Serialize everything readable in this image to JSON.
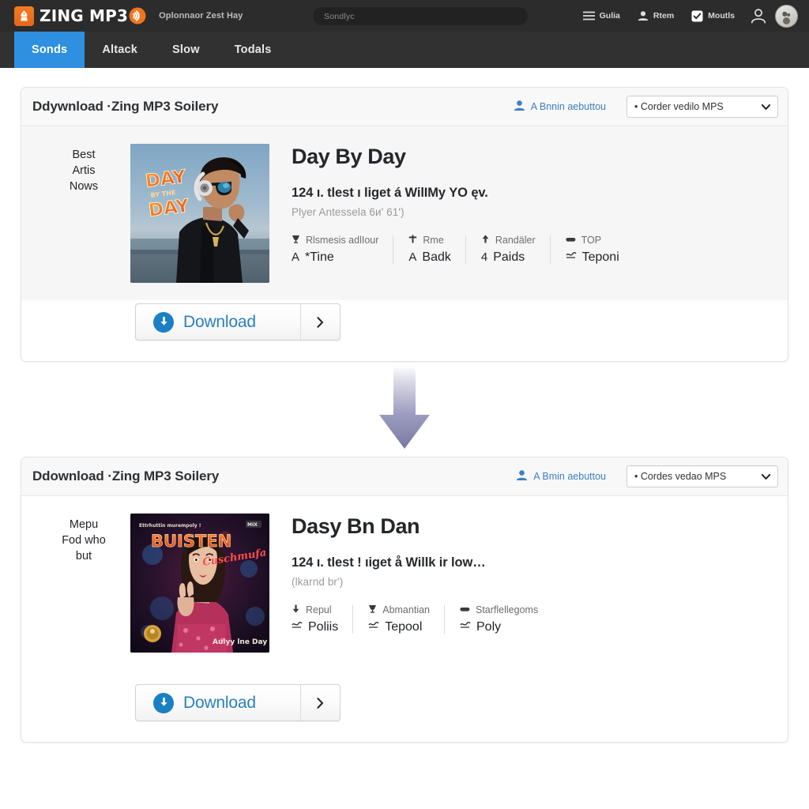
{
  "header": {
    "logo_text": "ZING MP3",
    "logo_icon": "flame-badge-icon",
    "wave_icon": "sound-wave-icon",
    "tagline": "Oplonnaor Zest Hay",
    "search": {
      "placeholder": "Sondlyc",
      "icon": "search-input"
    },
    "actions": [
      {
        "label": "Gulia",
        "icon": "hamburger-menu-icon"
      },
      {
        "label": "Rtem",
        "icon": "user-filled-icon"
      },
      {
        "label": "Moutls",
        "icon": "checkbox-checked-icon"
      }
    ],
    "account_icon": "user-outline-icon",
    "avatar": "avatar-image",
    "tabs": [
      {
        "label": "Sonds",
        "active": true
      },
      {
        "label": "Altack",
        "active": false
      },
      {
        "label": "Slow",
        "active": false
      },
      {
        "label": "Todals",
        "active": false
      }
    ]
  },
  "arrow": {
    "icon": "down-arrow-graphic",
    "color": "#7b7aa8"
  },
  "cards": [
    {
      "title": "Ddywnload ·Zing MP3 Soilery",
      "head_link": {
        "label": "A Bnnin aebuttou",
        "icon": "user-badge-icon"
      },
      "head_select": {
        "value": "• Corder vedilo MPS",
        "caret": "chevron-down-icon"
      },
      "side_note": "Best\nArtis\nNows",
      "art": {
        "name": "album-art-day-by-day",
        "overlay_text": "DAY\nBY\nDAY",
        "style": "male-singer-headphones"
      },
      "song_title": "Day By Day",
      "song_sub": "124 ı. tlest ı liget á WilIMy YO ęv.",
      "song_sub2": "Plyer Antessela 6и' 61')",
      "stats": [
        {
          "top_icon": "trophy-icon",
          "top": "Rlsmesis adlIour",
          "bot_icon": "letter-a-icon",
          "bot": "*Tine"
        },
        {
          "top_icon": "plus-bold-icon",
          "top": "Rme",
          "bot_icon": "letter-a-icon",
          "bot": "Badk"
        },
        {
          "top_icon": "up-arrow-icon",
          "top": "Randäler",
          "bot_icon": "digit-4-icon",
          "bot": "Paids"
        },
        {
          "top_icon": "tag-icon",
          "top": "TOP",
          "bot_icon": "scribble-icon",
          "bot": "Teponi"
        }
      ],
      "download": {
        "label": "Download",
        "icon": "download-circle-icon",
        "caret": "chevron-right-icon"
      }
    },
    {
      "title": "Ddownload ·Zing MP3 Soilery",
      "head_link": {
        "label": "A Bmin aebuttou",
        "icon": "user-badge-icon"
      },
      "head_select": {
        "value": "• Cordes vedao MPS",
        "caret": "chevron-down-icon"
      },
      "side_note": "Mepu\nFod who\nbut",
      "art": {
        "name": "album-art-buisten",
        "overlay_text": "BUISTEN",
        "overlay_top": "Ettrhuttin murempoly !",
        "overlay_script": "Cuschmufa",
        "overlay_bottom": "Aulyy lne Day",
        "style": "female-singer-peace-sign"
      },
      "song_title": "Dasy Bn Dan",
      "song_sub": "124 ı. tlest ! ıiget å Willk ir low…",
      "song_sub2": "(lkarnd brʹ)",
      "stats": [
        {
          "top_icon": "down-arrow-icon",
          "top": "Repul",
          "bot_icon": "scribble-icon",
          "bot": "Poliis"
        },
        {
          "top_icon": "trophy-icon",
          "top": "Abmantian",
          "bot_icon": "scribble-icon",
          "bot": "Tepool"
        },
        {
          "top_icon": "tag-icon",
          "top": "Starflellegoms",
          "bot_icon": "scribble-icon",
          "bot": "Poly"
        }
      ],
      "download": {
        "label": "Download",
        "icon": "download-circle-icon",
        "caret": "chevron-right-icon"
      }
    }
  ],
  "colors": {
    "accent_blue": "#2f8fe0",
    "link_blue": "#3d7fc1",
    "download_blue": "#1b7fc4",
    "logo_orange": "#f47b20",
    "topbar_dark": "#2c2c2c",
    "tabbar_dark": "#313131",
    "card_bg": "#f6f6f6"
  }
}
